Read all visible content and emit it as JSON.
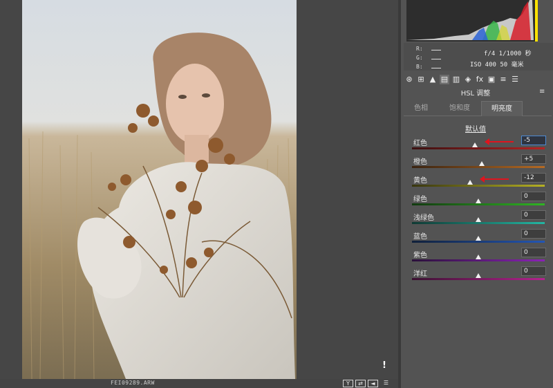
{
  "status_bar": {
    "filename": "FEI09289.ARW",
    "buttons": [
      "Y",
      "⇄",
      "◄",
      "☰"
    ],
    "clip_warning": "!"
  },
  "histogram": {
    "r_label": "R:",
    "g_label": "G:",
    "b_label": "B:",
    "aperture_shutter": "f/4  1/1000 秒",
    "iso_focal": "ISO 400  50 毫米"
  },
  "toolbar": {
    "icons": [
      "aperture-icon",
      "grid-icon",
      "mountain-icon",
      "hsl-icon",
      "split-tone-icon",
      "detail-icon",
      "fx-icon",
      "camera-calibration-icon",
      "presets-icon",
      "snapshots-icon"
    ],
    "glyphs": [
      "⊛",
      "⊞",
      "▲",
      "▤",
      "▥",
      "◈",
      "fx",
      "▣",
      "≡",
      "☰"
    ],
    "active_index": 3
  },
  "panel": {
    "title": "HSL 调整",
    "menu_glyph": "≡",
    "tabs": [
      {
        "label": "色相",
        "active": false
      },
      {
        "label": "饱和度",
        "active": false
      },
      {
        "label": "明亮度",
        "active": true
      }
    ],
    "default_link": "默认值"
  },
  "sliders": [
    {
      "label": "红色",
      "value": "-5",
      "level": -5,
      "min": -100,
      "max": 100,
      "focused": true,
      "arrow": true,
      "colors": [
        "#3a1010",
        "#b52323"
      ]
    },
    {
      "label": "橙色",
      "value": "+5",
      "level": 5,
      "min": -100,
      "max": 100,
      "focused": false,
      "arrow": false,
      "colors": [
        "#3a2310",
        "#b56a23"
      ]
    },
    {
      "label": "黄色",
      "value": "-12",
      "level": -12,
      "min": -100,
      "max": 100,
      "focused": false,
      "arrow": true,
      "colors": [
        "#38360f",
        "#b5b023"
      ]
    },
    {
      "label": "绿色",
      "value": "0",
      "level": 0,
      "min": -100,
      "max": 100,
      "focused": false,
      "arrow": false,
      "colors": [
        "#123a10",
        "#2fb523"
      ]
    },
    {
      "label": "浅绿色",
      "value": "0",
      "level": 0,
      "min": -100,
      "max": 100,
      "focused": false,
      "arrow": false,
      "colors": [
        "#103a34",
        "#23b5a2"
      ]
    },
    {
      "label": "蓝色",
      "value": "0",
      "level": 0,
      "min": -100,
      "max": 100,
      "focused": false,
      "arrow": false,
      "colors": [
        "#10203a",
        "#2356b5"
      ]
    },
    {
      "label": "紫色",
      "value": "0",
      "level": 0,
      "min": -100,
      "max": 100,
      "focused": false,
      "arrow": false,
      "colors": [
        "#2a103a",
        "#8a23b5"
      ]
    },
    {
      "label": "洋红",
      "value": "0",
      "level": 0,
      "min": -100,
      "max": 100,
      "focused": false,
      "arrow": false,
      "colors": [
        "#3a1030",
        "#b5238f"
      ]
    }
  ],
  "colors": {
    "arrow": "#e0141e",
    "focus": "#4d8bd4"
  }
}
